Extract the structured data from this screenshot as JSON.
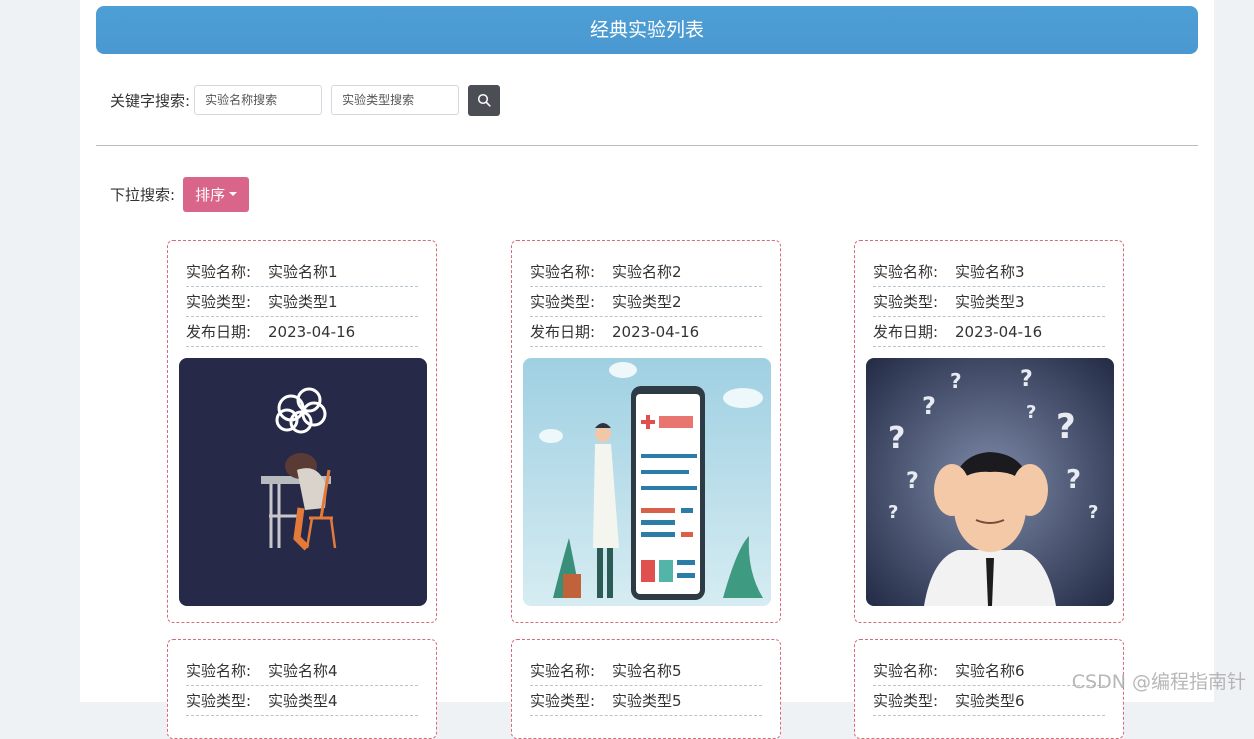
{
  "header": {
    "title": "经典实验列表"
  },
  "search": {
    "label": "关键字搜索:",
    "name_placeholder": "实验名称搜索",
    "type_placeholder": "实验类型搜索"
  },
  "sort": {
    "label": "下拉搜索:",
    "button_label": "排序"
  },
  "field_labels": {
    "name": "实验名称:",
    "type": "实验类型:",
    "date": "发布日期:"
  },
  "cards": [
    {
      "name": "实验名称1",
      "type": "实验类型1",
      "date": "2023-04-16",
      "image": "student-asleep-at-desk"
    },
    {
      "name": "实验名称2",
      "type": "实验类型2",
      "date": "2023-04-16",
      "image": "doctor-with-phone-chart"
    },
    {
      "name": "实验名称3",
      "type": "实验类型3",
      "date": "2023-04-16",
      "image": "confused-man-question-marks"
    },
    {
      "name": "实验名称4",
      "type": "实验类型4"
    },
    {
      "name": "实验名称5",
      "type": "实验类型5"
    },
    {
      "name": "实验名称6",
      "type": "实验类型6"
    }
  ],
  "watermark": "CSDN @编程指南针",
  "colors": {
    "title_bar": "#4e9fd6",
    "sort_button": "#d9658a",
    "search_button": "#4b4f55",
    "card_border": "#d86a7b"
  }
}
